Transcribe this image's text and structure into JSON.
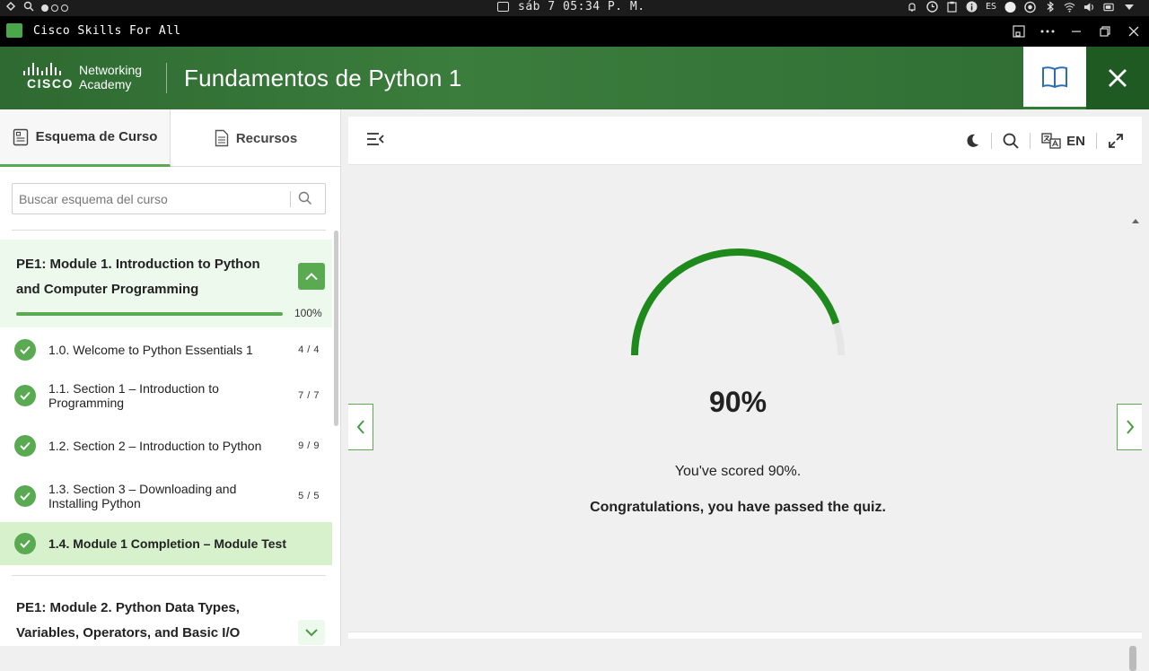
{
  "os": {
    "clock": "sáb 7 05:34 P. M.",
    "keyboard": "ES"
  },
  "app": {
    "title": "Cisco Skills For All"
  },
  "header": {
    "logo_cisco": "CISCO",
    "logo_line1": "Networking",
    "logo_line2": "Academy",
    "course_title": "Fundamentos de Python 1"
  },
  "sidebar": {
    "tabs": [
      {
        "label": "Esquema de Curso",
        "active": true
      },
      {
        "label": "Recursos",
        "active": false
      }
    ],
    "search_placeholder": "Buscar esquema del curso",
    "module1": {
      "title": "PE1: Module 1. Introduction to Python and Computer Programming",
      "progress": 100,
      "progress_label": "100%"
    },
    "items": [
      {
        "label": "1.0. Welcome to Python Essentials 1",
        "count": "4 / 4",
        "done": true,
        "active": false
      },
      {
        "label": "1.1. Section 1 – Introduction to Programming",
        "count": "7 / 7",
        "done": true,
        "active": false
      },
      {
        "label": "1.2. Section 2 – Introduction to Python",
        "count": "9 / 9",
        "done": true,
        "active": false
      },
      {
        "label": "1.3. Section 3 – Downloading and Installing Python",
        "count": "5 / 5",
        "done": true,
        "active": false
      },
      {
        "label": "1.4. Module 1 Completion – Module Test",
        "count": "",
        "done": true,
        "active": true
      }
    ],
    "module2": {
      "title": "PE1: Module 2. Python Data Types, Variables, Operators, and Basic I/O"
    }
  },
  "toolbar": {
    "language": "EN"
  },
  "result": {
    "score": 90,
    "score_label": "90%",
    "message": "You've scored 90%.",
    "status": "Congratulations, you have passed the quiz."
  },
  "colors": {
    "brand_green": "#2e6a31",
    "accent_green": "#5aaa52",
    "gauge_green": "#1f8a1c"
  }
}
